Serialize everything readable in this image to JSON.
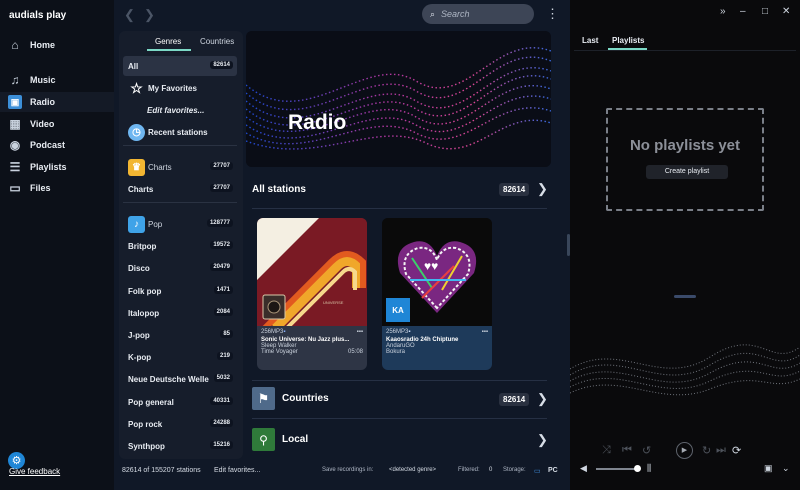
{
  "app": {
    "brand": "audials play"
  },
  "nav": {
    "items": [
      {
        "label": "Home",
        "icon": "home-icon"
      },
      {
        "label": "Music",
        "icon": "music-icon"
      },
      {
        "label": "Radio",
        "icon": "radio-icon"
      },
      {
        "label": "Video",
        "icon": "video-icon"
      },
      {
        "label": "Podcast",
        "icon": "podcast-icon"
      },
      {
        "label": "Playlists",
        "icon": "playlists-icon"
      },
      {
        "label": "Files",
        "icon": "folder-icon"
      }
    ],
    "active": "Radio",
    "feedback": "Give feedback"
  },
  "search": {
    "placeholder": "Search"
  },
  "genre_tabs": {
    "genres": "Genres",
    "countries": "Countries"
  },
  "genre_list": {
    "all": {
      "label": "All",
      "count": "82614"
    },
    "favorites": "My Favorites",
    "edit_favorites": "Edit favorites...",
    "recent": "Recent stations",
    "charts_header": {
      "label": "Charts",
      "count": "27707"
    },
    "charts": {
      "label": "Charts",
      "count": "27707"
    },
    "pop_header": {
      "label": "Pop",
      "count": "128777"
    },
    "pop_items": [
      {
        "label": "Britpop",
        "count": "19572"
      },
      {
        "label": "Disco",
        "count": "20479"
      },
      {
        "label": "Folk pop",
        "count": "1471"
      },
      {
        "label": "Italopop",
        "count": "2084"
      },
      {
        "label": "J-pop",
        "count": "85"
      },
      {
        "label": "K-pop",
        "count": "219"
      },
      {
        "label": "Neue Deutsche Welle",
        "count": "5032"
      },
      {
        "label": "Pop general",
        "count": "40331"
      },
      {
        "label": "Pop rock",
        "count": "24288"
      },
      {
        "label": "Synthpop",
        "count": "15216"
      }
    ]
  },
  "hero": {
    "title": "Radio"
  },
  "all_stations": {
    "label": "All stations",
    "count": "82614"
  },
  "stations": [
    {
      "quality": "256MP3",
      "title": "Sonic Universe: Nu Jazz plus...",
      "artist": "Sleep Walker",
      "song": "Time Voyager",
      "time": "05:08",
      "badge": ""
    },
    {
      "quality": "256MP3",
      "title": "Kaaosradio 24h Chiptune",
      "artist": "AndaruGO",
      "song": "Bokura",
      "time": "",
      "badge": "KA"
    }
  ],
  "countries": {
    "label": "Countries",
    "count": "82614"
  },
  "local": {
    "label": "Local"
  },
  "status": {
    "stations": "82614 of 155207 stations",
    "edit_favorites": "Edit favorites...",
    "save_label": "Save recordings in:",
    "save_value": "<detected genre>",
    "filtered_label": "Filtered:",
    "filtered_value": "0",
    "storage_label": "Storage:",
    "storage_value": "PC"
  },
  "right": {
    "tabs": [
      "Last",
      "Playlists"
    ],
    "active_tab": "Playlists",
    "empty_title": "No playlists yet",
    "create_button": "Create playlist"
  },
  "colors": {
    "accent": "#7cd9c6",
    "feedback": "#1f86d6",
    "main_bg": "#101827"
  }
}
